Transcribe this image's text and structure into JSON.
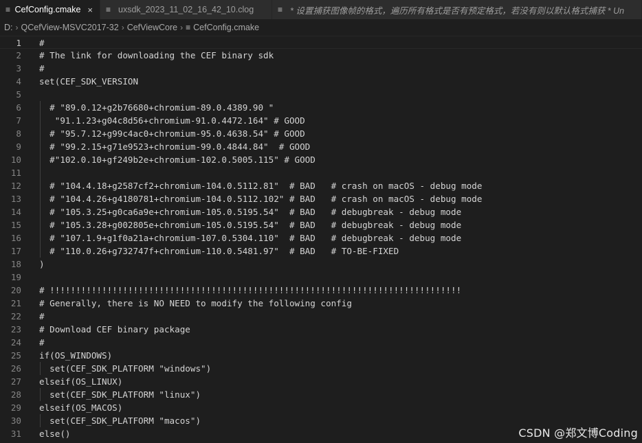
{
  "tabs": [
    {
      "label": "CefConfig.cmake",
      "active": true,
      "italic": false,
      "icon": "lines-file-icon",
      "close": "×"
    },
    {
      "label": "uxsdk_2023_11_02_16_42_10.clog",
      "active": false,
      "italic": false,
      "icon": "lines-file-icon",
      "close": ""
    },
    {
      "label": "* 设置捕获图像帧的格式，遍历所有格式是否有预定格式，若没有则以默认格式捕获 * Un",
      "active": false,
      "italic": true,
      "icon": "lines-file-icon",
      "close": ""
    }
  ],
  "breadcrumb": [
    "D:",
    "QCefView-MSVC2017-32",
    "CefViewCore",
    "CefConfig.cmake"
  ],
  "editor": {
    "current_line": 1,
    "lines": [
      {
        "n": "1",
        "text": "#"
      },
      {
        "n": "2",
        "text": "# The link for downloading the CEF binary sdk"
      },
      {
        "n": "3",
        "text": "#"
      },
      {
        "n": "4",
        "text": "set(CEF_SDK_VERSION"
      },
      {
        "n": "5",
        "text": ""
      },
      {
        "n": "6",
        "text": "  # \"89.0.12+g2b76680+chromium-89.0.4389.90 \""
      },
      {
        "n": "7",
        "text": "   \"91.1.23+g04c8d56+chromium-91.0.4472.164\" # GOOD"
      },
      {
        "n": "8",
        "text": "  # \"95.7.12+g99c4ac0+chromium-95.0.4638.54\" # GOOD"
      },
      {
        "n": "9",
        "text": "  # \"99.2.15+g71e9523+chromium-99.0.4844.84\"  # GOOD"
      },
      {
        "n": "10",
        "text": "  #\"102.0.10+gf249b2e+chromium-102.0.5005.115\" # GOOD"
      },
      {
        "n": "11",
        "text": ""
      },
      {
        "n": "12",
        "text": "  # \"104.4.18+g2587cf2+chromium-104.0.5112.81\"  # BAD   # crash on macOS - debug mode"
      },
      {
        "n": "13",
        "text": "  # \"104.4.26+g4180781+chromium-104.0.5112.102\" # BAD   # crash on macOS - debug mode"
      },
      {
        "n": "14",
        "text": "  # \"105.3.25+g0ca6a9e+chromium-105.0.5195.54\"  # BAD   # debugbreak - debug mode"
      },
      {
        "n": "15",
        "text": "  # \"105.3.28+g002805e+chromium-105.0.5195.54\"  # BAD   # debugbreak - debug mode"
      },
      {
        "n": "16",
        "text": "  # \"107.1.9+g1f0a21a+chromium-107.0.5304.110\"  # BAD   # debugbreak - debug mode"
      },
      {
        "n": "17",
        "text": "  # \"110.0.26+g732747f+chromium-110.0.5481.97\"  # BAD   # TO-BE-FIXED"
      },
      {
        "n": "18",
        "text": ")"
      },
      {
        "n": "19",
        "text": ""
      },
      {
        "n": "20",
        "text": "# !!!!!!!!!!!!!!!!!!!!!!!!!!!!!!!!!!!!!!!!!!!!!!!!!!!!!!!!!!!!!!!!!!!!!!!!!!!!!!!"
      },
      {
        "n": "21",
        "text": "# Generally, there is NO NEED to modify the following config"
      },
      {
        "n": "22",
        "text": "#"
      },
      {
        "n": "23",
        "text": "# Download CEF binary package"
      },
      {
        "n": "24",
        "text": "#"
      },
      {
        "n": "25",
        "text": "if(OS_WINDOWS)"
      },
      {
        "n": "26",
        "text": "  set(CEF_SDK_PLATFORM \"windows\")"
      },
      {
        "n": "27",
        "text": "elseif(OS_LINUX)"
      },
      {
        "n": "28",
        "text": "  set(CEF_SDK_PLATFORM \"linux\")"
      },
      {
        "n": "29",
        "text": "elseif(OS_MACOS)"
      },
      {
        "n": "30",
        "text": "  set(CEF_SDK_PLATFORM \"macos\")"
      },
      {
        "n": "31",
        "text": "else()"
      }
    ]
  },
  "watermark": "CSDN @郑文博Coding"
}
